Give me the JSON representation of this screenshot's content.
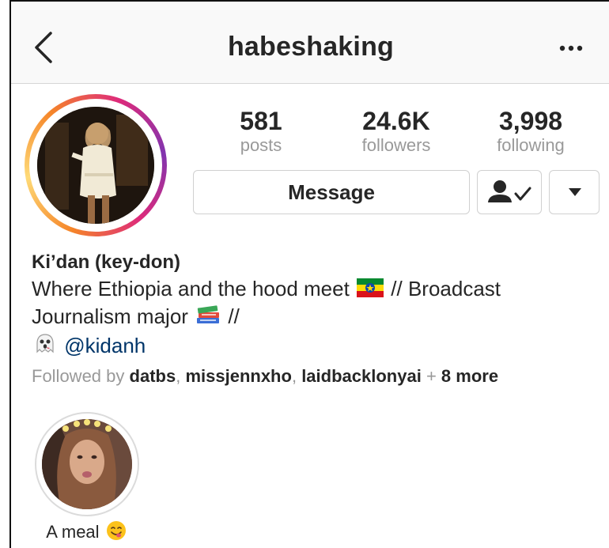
{
  "header": {
    "username": "habeshaking",
    "back_icon": "chevron-left-icon",
    "more_icon": "more-horizontal-icon"
  },
  "stats": {
    "posts": {
      "value": "581",
      "label": "posts"
    },
    "followers": {
      "value": "24.6K",
      "label": "followers"
    },
    "following": {
      "value": "3,998",
      "label": "following"
    }
  },
  "actions": {
    "message_label": "Message",
    "following_icon": "person-check-icon",
    "dropdown_icon": "caret-down-icon"
  },
  "bio": {
    "name": "Ki’dan (key-don)",
    "line1_text": "Where Ethiopia and the hood meet",
    "line1_emoji": "ethiopia-flag-icon",
    "line1_suffix": "// Broadcast",
    "line2_text": "Journalism major",
    "line2_emoji": "books-icon",
    "line2_suffix": "//",
    "line3_emoji": "ghost-icon",
    "snapchat_handle": "@kidanh"
  },
  "followed_by": {
    "prefix": "Followed by",
    "users": [
      "datbs",
      "missjennxho",
      "laidbacklonyai"
    ],
    "separator": ",",
    "plus": "+",
    "more": "8 more"
  },
  "highlights": [
    {
      "label": "A meal",
      "emoji": "face-savoring-food-icon"
    }
  ],
  "colors": {
    "text": "#262626",
    "secondary": "#999999",
    "link": "#003569",
    "border": "#d0d0d0",
    "nav_bg": "#f9f9f9"
  }
}
